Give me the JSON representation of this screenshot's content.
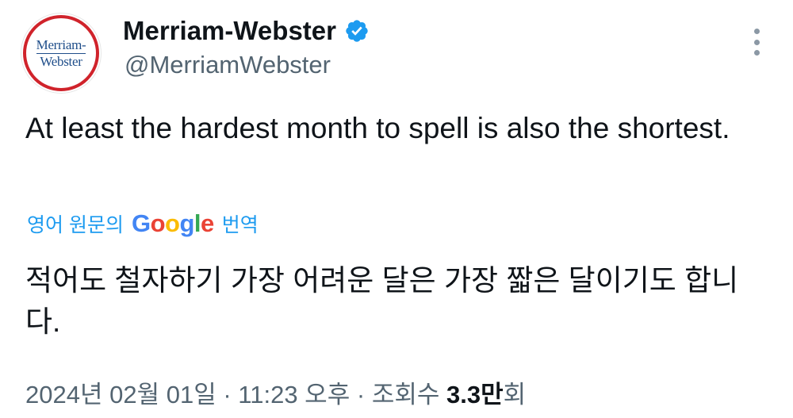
{
  "author": {
    "logo_line1": "Merriam-",
    "logo_line2": "Webster",
    "display_name": "Merriam-Webster",
    "handle": "@MerriamWebster",
    "verified": true,
    "verified_color": "#1d9bf0"
  },
  "tweet": {
    "text": "At least the hardest month to spell is also the shortest.",
    "translate_prefix": "영어 원문의",
    "translate_brand": [
      "G",
      "o",
      "o",
      "g",
      "l",
      "e"
    ],
    "translate_suffix": "번역",
    "translated_text": "적어도 철자하기 가장 어려운 달은 가장 짧은 달이기도 합니다."
  },
  "meta": {
    "date": "2024년 02월 01일",
    "separator": "·",
    "time": "11:23 오후",
    "views_label": "조회수",
    "views_count": "3.3만",
    "views_suffix": "회"
  },
  "icons": {
    "verified": "verified-badge-icon",
    "more": "more-vertical-icon"
  }
}
